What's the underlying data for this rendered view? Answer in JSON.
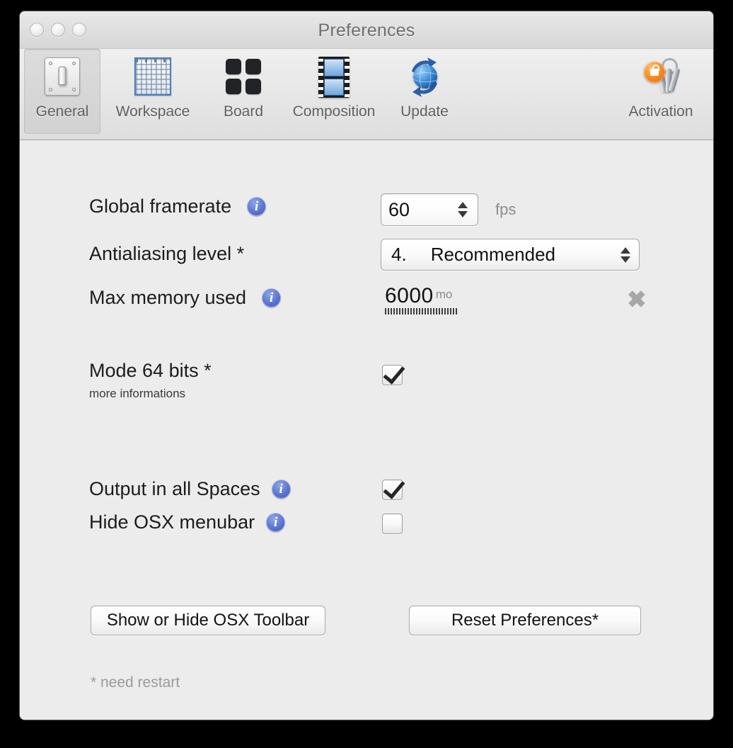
{
  "window": {
    "title": "Preferences",
    "traffic_lights": [
      "close",
      "minimize",
      "zoom"
    ]
  },
  "toolbar": {
    "items": [
      {
        "id": "general",
        "label": "General",
        "icon": "light-switch-icon",
        "selected": true
      },
      {
        "id": "workspace",
        "label": "Workspace",
        "icon": "grid-icon",
        "selected": false
      },
      {
        "id": "board",
        "label": "Board",
        "icon": "board-squares-icon",
        "selected": false
      },
      {
        "id": "composition",
        "label": "Composition",
        "icon": "filmstrip-icon",
        "selected": false
      },
      {
        "id": "update",
        "label": "Update",
        "icon": "globe-refresh-icon",
        "selected": false
      },
      {
        "id": "activation",
        "label": "Activation",
        "icon": "keychain-icon",
        "selected": false
      }
    ]
  },
  "general": {
    "framerate": {
      "label": "Global framerate",
      "info": "i",
      "value": "60",
      "unit": "fps"
    },
    "antialiasing": {
      "label": "Antialiasing level *",
      "selected_number": "4.",
      "selected_text": "Recommended",
      "options": [
        "4.   Recommended"
      ]
    },
    "memory": {
      "label": "Max memory used",
      "info": "i",
      "value": "6000",
      "unit": "mo",
      "clear_glyph": "✖"
    },
    "mode64": {
      "label": "Mode 64 bits *",
      "sublabel": "more informations",
      "checked": true
    },
    "spaces": {
      "label": "Output in all Spaces",
      "info": "i",
      "checked": true
    },
    "menubar": {
      "label": "Hide OSX menubar",
      "info": "i",
      "checked": false
    },
    "buttons": {
      "toolbar_toggle": "Show or Hide OSX Toolbar",
      "reset": "Reset Preferences*"
    },
    "footnote": "* need restart"
  },
  "colors": {
    "window_bg": "#ececec",
    "toolbar_bg": "#e6e6e6",
    "accent_info": "#5a73cf",
    "accent_activation": "#f98b22",
    "text": "#1c1c1c",
    "muted_text": "#8c8c8c"
  }
}
